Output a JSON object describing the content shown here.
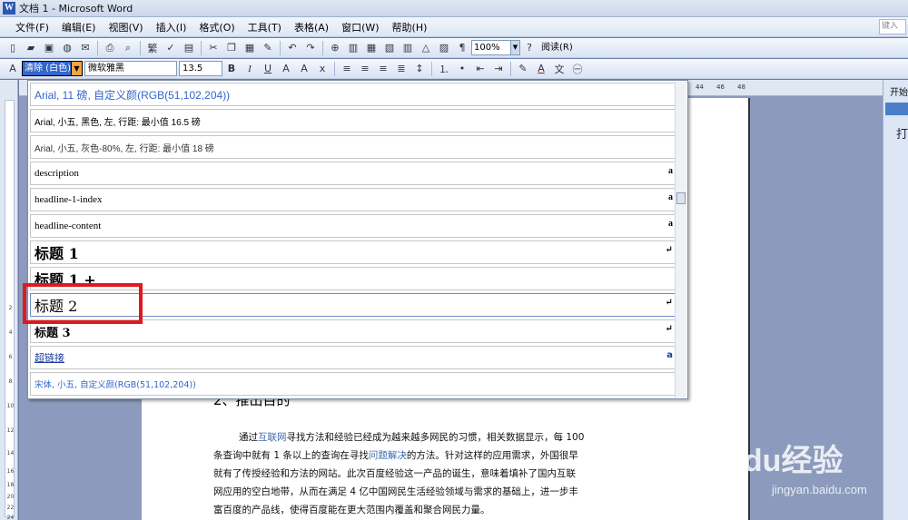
{
  "window": {
    "title": "文档 1 - Microsoft Word"
  },
  "menu": [
    "文件(F)",
    "编辑(E)",
    "视图(V)",
    "插入(I)",
    "格式(O)",
    "工具(T)",
    "表格(A)",
    "窗口(W)",
    "帮助(H)"
  ],
  "ask_box": "键入",
  "toolbar": {
    "zoom": "100%",
    "read_label": "阅读(R)"
  },
  "format_bar": {
    "style_value": "清除 (白色)",
    "font_value": "微软雅黑",
    "size_value": "13.5"
  },
  "ruler_numbers": [
    "44",
    "46",
    "48"
  ],
  "vruler_numbers": [
    "2",
    "4",
    "6",
    "8",
    "10",
    "12",
    "14",
    "16",
    "18",
    "20",
    "22",
    "24"
  ],
  "style_list": [
    {
      "label": "Arial, 11 磅, 自定义颜(RGB(51,102,204))",
      "mark": ""
    },
    {
      "label": "Arial, 小五, 黑色, 左, 行距: 最小值 16.5 磅",
      "mark": ""
    },
    {
      "label": "Arial, 小五, 灰色-80%, 左, 行距: 最小值 18 磅",
      "mark": ""
    },
    {
      "label": "description",
      "mark": "a"
    },
    {
      "label": "headline-1-index",
      "mark": "a"
    },
    {
      "label": "headline-content",
      "mark": "a"
    },
    {
      "label": "标题 1",
      "mark": "↵"
    },
    {
      "label": "标题 1 +",
      "mark": ""
    },
    {
      "label": "标题 2",
      "mark": "↵"
    },
    {
      "label": "标题 3",
      "mark": "↵"
    },
    {
      "label": "超链接",
      "mark": "a"
    },
    {
      "label": "宋体, 小五, 自定义颜(RGB(51,102,204))",
      "mark": ""
    }
  ],
  "document": {
    "heading": "2、推出目的",
    "p1_a": "通过",
    "p1_link1": "互联网",
    "p1_b": "寻找方法和经验已经成为越来越多网民的习惯，相关数据显示，每 100",
    "p2_a": "条查询中就有 1 条以上的查询在寻找",
    "p2_link": "问题解决",
    "p2_b": "的方法。针对这样的应用需求，外国很早",
    "p3": "就有了传授经验和方法的网站。此次百度经验这一产品的诞生，意味着填补了国内互联",
    "p4": "网应用的空白地带，从而在满足 4 亿中国网民生活经验领域与需求的基础上，进一步丰",
    "p5": "富百度的产品线，使得百度能在更大范围内覆盖和聚合网民力量。"
  },
  "task_pane": {
    "title": "开始",
    "label": "打"
  },
  "watermark": {
    "main": "Baidu经验",
    "sub": "jingyan.baidu.com"
  },
  "colors": {
    "highlight": "#e0191e",
    "selected_style_bg": "#3366cc",
    "link": "#3b6bb0"
  }
}
